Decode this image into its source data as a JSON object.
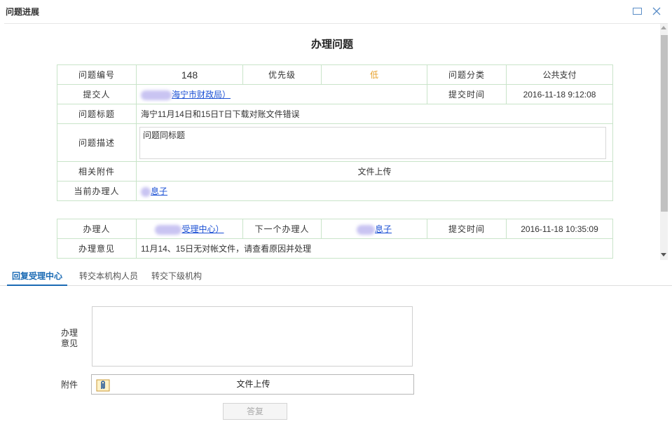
{
  "window": {
    "title": "问题进展"
  },
  "heading": "办理问题",
  "issue": {
    "id_label": "问题编号",
    "id_value": "148",
    "priority_label": "优先级",
    "priority_value": "低",
    "category_label": "问题分类",
    "category_value": "公共支付",
    "submitter_label": "提交人",
    "submitter_value": "海宁市财政局）",
    "submit_time_label": "提交时间",
    "submit_time_value": "2016-11-18 9:12:08",
    "title_label": "问题标题",
    "title_value": "海宁11月14日和15日T日下载对账文件错误",
    "desc_label": "问题描述",
    "desc_value": "问题同标题",
    "attach_label": "相关附件",
    "attach_value": "文件上传",
    "handler_label": "当前办理人",
    "handler_value": "息子"
  },
  "history": {
    "handler_label": "办理人",
    "handler_value": "受理中心）",
    "next_label": "下一个办理人",
    "next_value": "息子",
    "time_label": "提交时间",
    "time_value": "2016-11-18 10:35:09",
    "opinion_label": "办理意见",
    "opinion_value": "11月14、15日无对帐文件，请查看原因并处理"
  },
  "tabs": [
    {
      "label": "回复受理中心",
      "active": true
    },
    {
      "label": "转交本机构人员",
      "active": false
    },
    {
      "label": "转交下级机构",
      "active": false
    }
  ],
  "form": {
    "opinion_label_line1": "办理",
    "opinion_label_line2": "意见",
    "opinion_value": "",
    "attach_label": "附件",
    "upload_label": "文件上传",
    "submit_label": "答复"
  },
  "colors": {
    "accent": "#1a6ab4",
    "table_border": "#c9e4c9",
    "priority": "#e8a12b",
    "link": "#1a4fd4"
  }
}
